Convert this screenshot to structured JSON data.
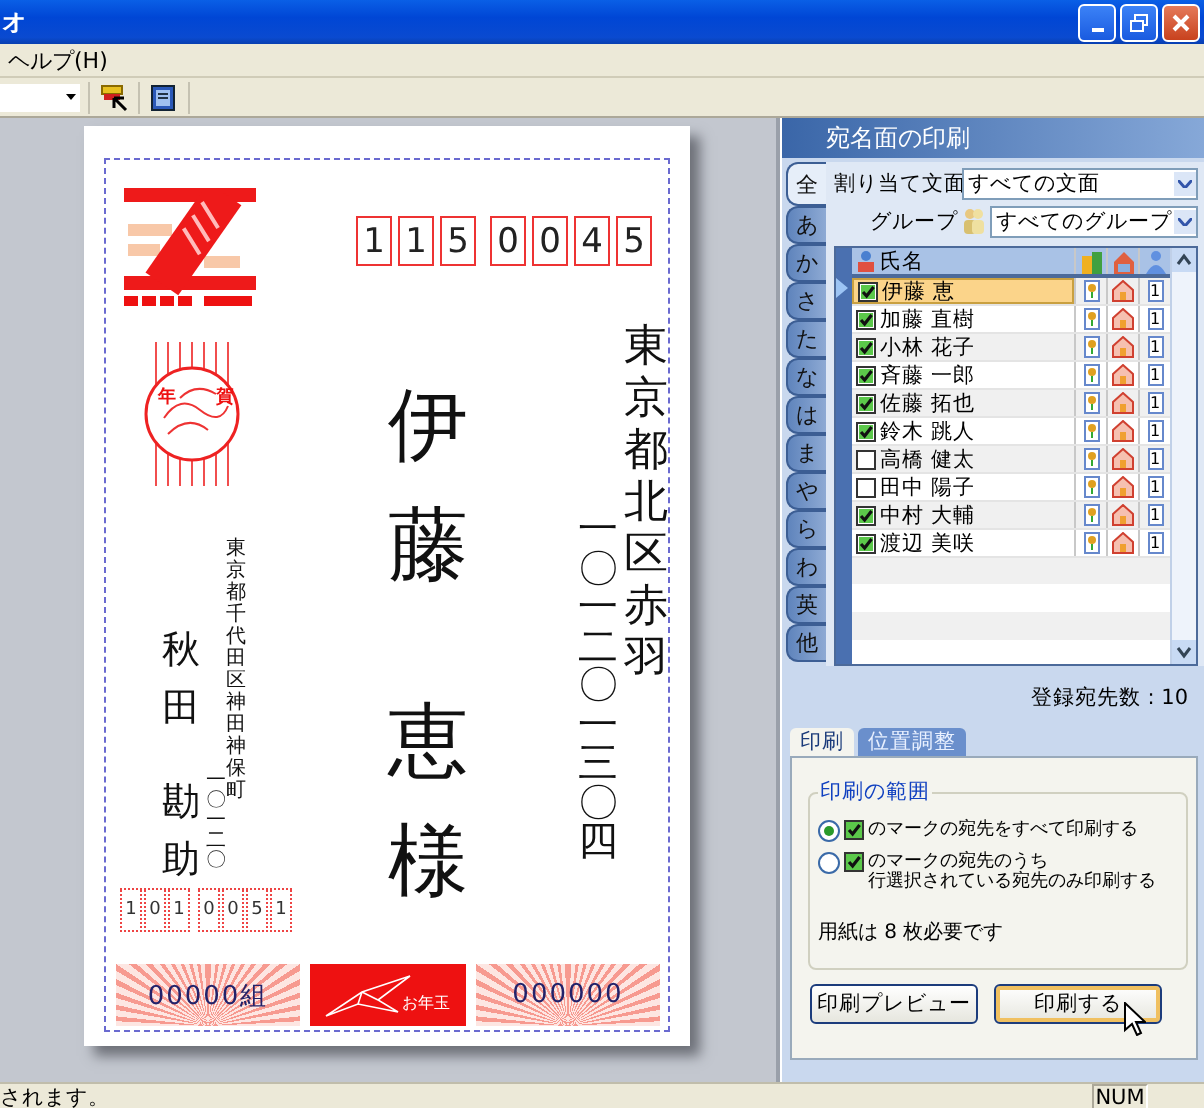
{
  "window": {
    "title": "オ"
  },
  "menu": [
    "ヘルプ(H)"
  ],
  "postcard": {
    "postal_code": [
      "1",
      "1",
      "5",
      "0",
      "0",
      "4",
      "5"
    ],
    "postmark": [
      "年",
      "賀"
    ],
    "recipient_address": [
      "東京都北区赤羽",
      "一〇一二〇一三〇四"
    ],
    "recipient": {
      "family_name": "伊藤",
      "given_name": "恵",
      "honorific": "様"
    },
    "sender_address": [
      "東京都千代田区神田神保町",
      "一〇一二〇"
    ],
    "sender": {
      "family_name": "秋田",
      "given_name": "勘助"
    },
    "sender_postal_code": [
      "1",
      "0",
      "1",
      "0",
      "0",
      "5",
      "1"
    ],
    "lottery": {
      "group": "00000組",
      "gift": "お年玉",
      "number": "000000"
    }
  },
  "address_panel": {
    "title": "宛名面の印刷",
    "index_tabs": [
      {
        "label": "全",
        "selected": true
      },
      {
        "label": "あ",
        "selected": false
      },
      {
        "label": "か",
        "selected": false
      },
      {
        "label": "さ",
        "selected": false
      },
      {
        "label": "た",
        "selected": false
      },
      {
        "label": "な",
        "selected": false
      },
      {
        "label": "は",
        "selected": false
      },
      {
        "label": "ま",
        "selected": false
      },
      {
        "label": "や",
        "selected": false
      },
      {
        "label": "ら",
        "selected": false
      },
      {
        "label": "わ",
        "selected": false
      },
      {
        "label": "英",
        "selected": false
      },
      {
        "label": "他",
        "selected": false
      }
    ],
    "template": {
      "label": "割り当て文面",
      "value": "すべての文面"
    },
    "group": {
      "label": "グループ",
      "value": "すべてのグループ"
    },
    "list": {
      "name_column": "氏名",
      "rows": [
        {
          "name": "伊藤 恵",
          "checked": true,
          "selected": true,
          "copies": "1"
        },
        {
          "name": "加藤 直樹",
          "checked": true,
          "selected": false,
          "copies": "1"
        },
        {
          "name": "小林 花子",
          "checked": true,
          "selected": false,
          "copies": "1"
        },
        {
          "name": "斉藤 一郎",
          "checked": true,
          "selected": false,
          "copies": "1"
        },
        {
          "name": "佐藤 拓也",
          "checked": true,
          "selected": false,
          "copies": "1"
        },
        {
          "name": "鈴木 跳人",
          "checked": true,
          "selected": false,
          "copies": "1"
        },
        {
          "name": "高橋 健太",
          "checked": false,
          "selected": false,
          "copies": "1"
        },
        {
          "name": "田中 陽子",
          "checked": false,
          "selected": false,
          "copies": "1"
        },
        {
          "name": "中村 大輔",
          "checked": true,
          "selected": false,
          "copies": "1"
        },
        {
          "name": "渡辺 美咲",
          "checked": true,
          "selected": false,
          "copies": "1"
        }
      ]
    },
    "count": "登録宛先数 : 10",
    "tabs": [
      {
        "label": "印刷",
        "selected": true
      },
      {
        "label": "位置調整",
        "selected": false
      }
    ],
    "range": {
      "title": "印刷の範囲",
      "options": [
        {
          "lines": [
            "のマークの宛先をすべて印刷する"
          ],
          "selected": true
        },
        {
          "lines": [
            "のマークの宛先のうち",
            "行選択されている宛先のみ印刷する"
          ],
          "selected": false
        }
      ]
    },
    "paper_note": "用紙は 8 枚必要です",
    "buttons": [
      "印刷プレビュー",
      "印刷する"
    ]
  },
  "status_bar": {
    "message": "されます。",
    "num": "NUM"
  }
}
